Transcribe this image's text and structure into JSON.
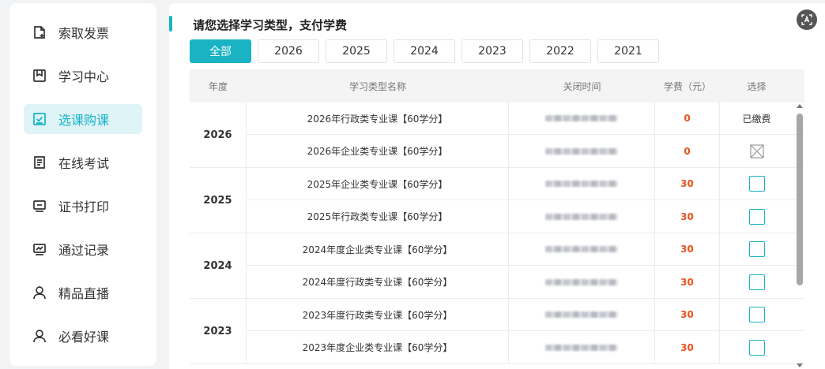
{
  "sidebar": {
    "items": [
      {
        "label": "索取发票",
        "icon": "invoice-icon"
      },
      {
        "label": "学习中心",
        "icon": "bookmark-icon"
      },
      {
        "label": "选课购课",
        "icon": "checkbox-icon",
        "active": true
      },
      {
        "label": "在线考试",
        "icon": "document-icon"
      },
      {
        "label": "证书打印",
        "icon": "monitor-icon"
      },
      {
        "label": "通过记录",
        "icon": "chart-icon"
      },
      {
        "label": "精品直播",
        "icon": "user-icon"
      },
      {
        "label": "必看好课",
        "icon": "user-icon"
      }
    ]
  },
  "main": {
    "title": "请您选择学习类型，支付学费",
    "year_tabs": [
      "全部",
      "2026",
      "2025",
      "2024",
      "2023",
      "2022",
      "2021"
    ],
    "active_tab": "全部",
    "table": {
      "headers": [
        "年度",
        "学习类型名称",
        "关闭时间",
        "学费（元）",
        "选择"
      ],
      "groups": [
        {
          "year": "2026",
          "rows": [
            {
              "name": "2026年行政类专业课【60学分】",
              "fee": "0",
              "select": "paid",
              "select_text": "已缴费"
            },
            {
              "name": "2026年企业类专业课【60学分】",
              "fee": "0",
              "select": "disabled"
            }
          ]
        },
        {
          "year": "2025",
          "rows": [
            {
              "name": "2025年企业类专业课【60学分】",
              "fee": "30",
              "select": "checkbox"
            },
            {
              "name": "2025年行政类专业课【60学分】",
              "fee": "30",
              "select": "checkbox"
            }
          ]
        },
        {
          "year": "2024",
          "rows": [
            {
              "name": "2024年度企业类专业课【60学分】",
              "fee": "30",
              "select": "checkbox"
            },
            {
              "name": "2024年度行政类专业课【60学分】",
              "fee": "30",
              "select": "checkbox"
            }
          ]
        },
        {
          "year": "2023",
          "rows": [
            {
              "name": "2023年度行政类专业课【60学分】",
              "fee": "30",
              "select": "checkbox"
            },
            {
              "name": "2023年度企业类专业课【60学分】",
              "fee": "30",
              "select": "checkbox"
            }
          ]
        }
      ]
    }
  },
  "colors": {
    "accent": "#19b3c4",
    "fee": "#e8541e",
    "active_bg": "#dff4f7"
  }
}
